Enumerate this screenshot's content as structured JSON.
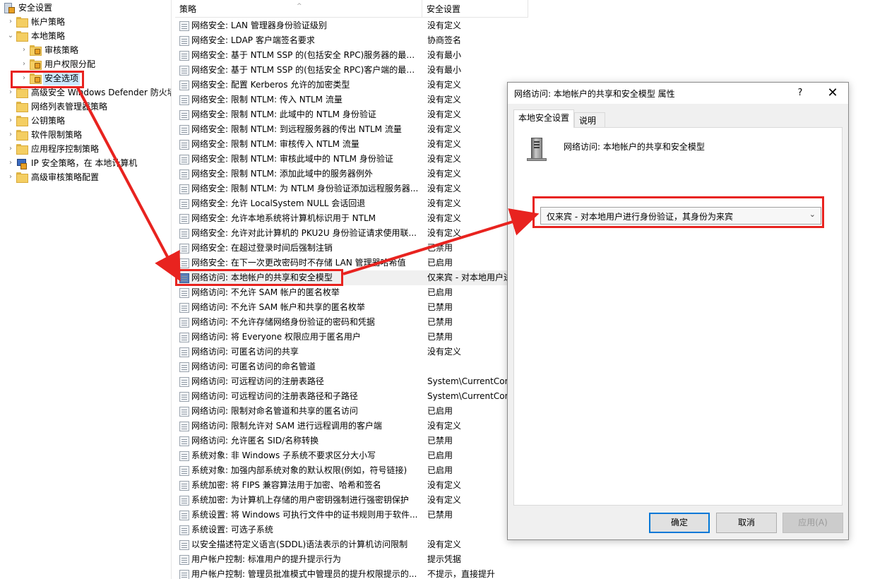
{
  "tree": {
    "root": "安全设置",
    "items": [
      {
        "label": "帐户策略",
        "expand": "›",
        "indent": 1,
        "icon": "folder"
      },
      {
        "label": "本地策略",
        "expand": "⌄",
        "indent": 1,
        "icon": "folder"
      },
      {
        "label": "审核策略",
        "expand": "›",
        "indent": 2,
        "icon": "folder-lock"
      },
      {
        "label": "用户权限分配",
        "expand": "›",
        "indent": 2,
        "icon": "folder-lock"
      },
      {
        "label": "安全选项",
        "expand": "›",
        "indent": 2,
        "icon": "folder-lock",
        "selected": true
      },
      {
        "label": "高级安全 Windows Defender 防火墙",
        "expand": "›",
        "indent": 1,
        "icon": "folder"
      },
      {
        "label": "网络列表管理器策略",
        "expand": "",
        "indent": 1,
        "icon": "folder"
      },
      {
        "label": "公钥策略",
        "expand": "›",
        "indent": 1,
        "icon": "folder"
      },
      {
        "label": "软件限制策略",
        "expand": "›",
        "indent": 1,
        "icon": "folder"
      },
      {
        "label": "应用程序控制策略",
        "expand": "›",
        "indent": 1,
        "icon": "folder"
      },
      {
        "label": "IP 安全策略，在 本地计算机",
        "expand": "›",
        "indent": 1,
        "icon": "ip-security"
      },
      {
        "label": "高级审核策略配置",
        "expand": "›",
        "indent": 1,
        "icon": "folder"
      }
    ]
  },
  "list": {
    "col_policy": "策略",
    "col_setting": "安全设置",
    "sort_arrow": "^",
    "rows": [
      {
        "policy": "网络安全: LAN 管理器身份验证级别",
        "setting": "没有定义"
      },
      {
        "policy": "网络安全: LDAP 客户端签名要求",
        "setting": "协商签名"
      },
      {
        "policy": "网络安全: 基于 NTLM SSP 的(包括安全 RPC)服务器的最小...",
        "setting": "没有最小"
      },
      {
        "policy": "网络安全: 基于 NTLM SSP 的(包括安全 RPC)客户端的最小...",
        "setting": "没有最小"
      },
      {
        "policy": "网络安全: 配置 Kerberos 允许的加密类型",
        "setting": "没有定义"
      },
      {
        "policy": "网络安全: 限制 NTLM: 传入 NTLM 流量",
        "setting": "没有定义"
      },
      {
        "policy": "网络安全: 限制 NTLM: 此域中的 NTLM 身份验证",
        "setting": "没有定义"
      },
      {
        "policy": "网络安全: 限制 NTLM: 到远程服务器的传出 NTLM 流量",
        "setting": "没有定义"
      },
      {
        "policy": "网络安全: 限制 NTLM: 审核传入 NTLM 流量",
        "setting": "没有定义"
      },
      {
        "policy": "网络安全: 限制 NTLM: 审核此域中的 NTLM 身份验证",
        "setting": "没有定义"
      },
      {
        "policy": "网络安全: 限制 NTLM: 添加此域中的服务器例外",
        "setting": "没有定义"
      },
      {
        "policy": "网络安全: 限制 NTLM: 为 NTLM 身份验证添加远程服务器...",
        "setting": "没有定义"
      },
      {
        "policy": "网络安全: 允许 LocalSystem NULL 会话回退",
        "setting": "没有定义"
      },
      {
        "policy": "网络安全: 允许本地系统将计算机标识用于 NTLM",
        "setting": "没有定义"
      },
      {
        "policy": "网络安全: 允许对此计算机的 PKU2U 身份验证请求使用联...",
        "setting": "没有定义"
      },
      {
        "policy": "网络安全: 在超过登录时间后强制注销",
        "setting": "已禁用"
      },
      {
        "policy": "网络安全: 在下一次更改密码时不存储 LAN 管理器哈希值",
        "setting": "已启用"
      },
      {
        "policy": "网络访问: 本地帐户的共享和安全模型",
        "setting": "仅来宾 - 对本地用户进",
        "selected": true
      },
      {
        "policy": "网络访问: 不允许 SAM 帐户的匿名枚举",
        "setting": "已启用"
      },
      {
        "policy": "网络访问: 不允许 SAM 帐户和共享的匿名枚举",
        "setting": "已禁用"
      },
      {
        "policy": "网络访问: 不允许存储网络身份验证的密码和凭据",
        "setting": "已禁用"
      },
      {
        "policy": "网络访问: 将 Everyone 权限应用于匿名用户",
        "setting": "已禁用"
      },
      {
        "policy": "网络访问: 可匿名访问的共享",
        "setting": "没有定义"
      },
      {
        "policy": "网络访问: 可匿名访问的命名管道",
        "setting": ""
      },
      {
        "policy": "网络访问: 可远程访问的注册表路径",
        "setting": "System\\CurrentControl"
      },
      {
        "policy": "网络访问: 可远程访问的注册表路径和子路径",
        "setting": "System\\CurrentControl"
      },
      {
        "policy": "网络访问: 限制对命名管道和共享的匿名访问",
        "setting": "已启用"
      },
      {
        "policy": "网络访问: 限制允许对 SAM 进行远程调用的客户端",
        "setting": "没有定义"
      },
      {
        "policy": "网络访问: 允许匿名 SID/名称转换",
        "setting": "已禁用"
      },
      {
        "policy": "系统对象: 非 Windows 子系统不要求区分大小写",
        "setting": "已启用"
      },
      {
        "policy": "系统对象: 加强内部系统对象的默认权限(例如，符号链接)",
        "setting": "已启用"
      },
      {
        "policy": "系统加密: 将 FIPS 兼容算法用于加密、哈希和签名",
        "setting": "没有定义"
      },
      {
        "policy": "系统加密: 为计算机上存储的用户密钥强制进行强密钥保护",
        "setting": "没有定义"
      },
      {
        "policy": "系统设置: 将 Windows 可执行文件中的证书规则用于软件...",
        "setting": "已禁用"
      },
      {
        "policy": "系统设置: 可选子系统",
        "setting": ""
      },
      {
        "policy": "以安全描述符定义语言(SDDL)语法表示的计算机访问限制",
        "setting": "没有定义"
      },
      {
        "policy": "用户帐户控制: 标准用户的提升提示行为",
        "setting": "提示凭据"
      },
      {
        "policy": "用户帐户控制: 管理员批准模式中管理员的提升权限提示的...",
        "setting": "不提示，直接提升"
      }
    ]
  },
  "dialog": {
    "title": "网络访问: 本地帐户的共享和安全模型 属性",
    "help": "?",
    "close": "✕",
    "tab_local": "本地安全设置",
    "tab_explain": "说明",
    "policy_name": "网络访问: 本地帐户的共享和安全模型",
    "select_value": "仅来宾 - 对本地用户进行身份验证，其身份为来宾",
    "select_chevron": "⌄",
    "ok": "确定",
    "cancel": "取消",
    "apply": "应用(A)"
  },
  "colors": {
    "annotation": "#e8231f",
    "selection": "#cce8ff",
    "ok_border": "#0078d7"
  }
}
